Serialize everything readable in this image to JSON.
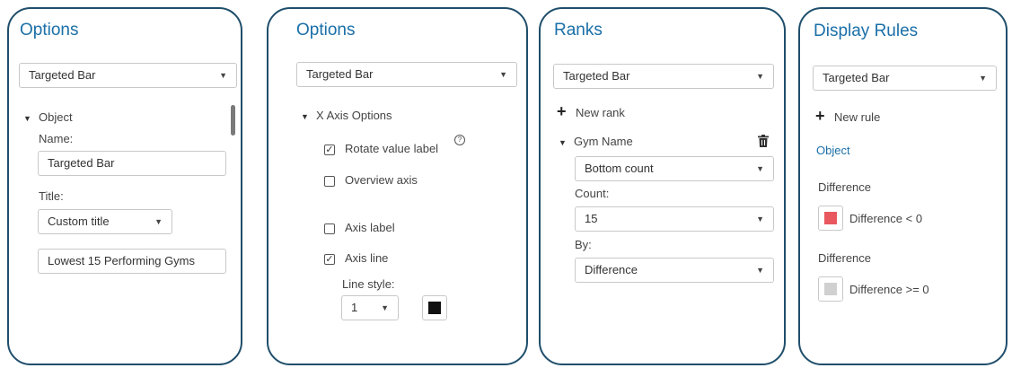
{
  "panels": {
    "options1": {
      "title": "Options",
      "dropdown": "Targeted Bar",
      "section_label": "Object",
      "name_label": "Name:",
      "name_value": "Targeted Bar",
      "title_label": "Title:",
      "title_mode": "Custom title",
      "title_value": "Lowest 15 Performing Gyms"
    },
    "options2": {
      "title": "Options",
      "dropdown": "Targeted Bar",
      "section_label": "X Axis Options",
      "rotate_label": "Rotate value label",
      "rotate_checked": true,
      "overview_label": "Overview axis",
      "overview_checked": false,
      "axis_label_label": "Axis label",
      "axis_label_checked": false,
      "axis_line_label": "Axis line",
      "axis_line_checked": true,
      "line_style_label": "Line style:",
      "line_style_value": "1",
      "line_color": "#111111"
    },
    "ranks": {
      "title": "Ranks",
      "dropdown": "Targeted Bar",
      "new_rank_label": "New rank",
      "rank_item": "Gym Name",
      "rank_type": "Bottom count",
      "count_label": "Count:",
      "count_value": "15",
      "by_label": "By:",
      "by_value": "Difference"
    },
    "display_rules": {
      "title": "Display Rules",
      "dropdown": "Targeted Bar",
      "new_rule_label": "New rule",
      "object_link": "Object",
      "rule1_heading": "Difference",
      "rule1_label": "Difference < 0",
      "rule1_color": "#e8585e",
      "rule2_heading": "Difference",
      "rule2_label": "Difference >= 0",
      "rule2_color": "#d0d0d0"
    }
  },
  "icons": {
    "dropdown": "chevron-down-icon",
    "expand": "triangle-down-icon",
    "add": "plus-icon",
    "delete": "trash-icon",
    "help": "help-icon",
    "check": "checkmark-icon"
  },
  "colors": {
    "accent": "#1a6fa8",
    "panel_border": "#1f4e6b"
  }
}
